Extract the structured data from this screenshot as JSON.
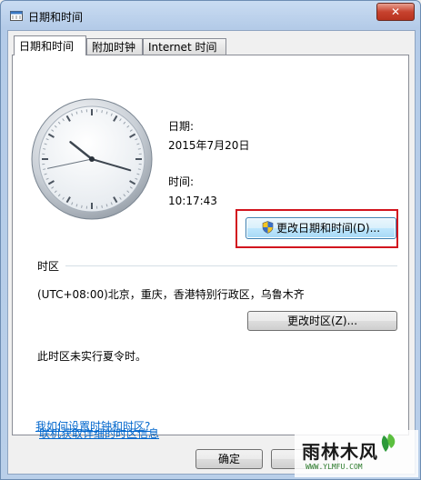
{
  "window": {
    "title": "日期和时间",
    "close_label": "✕"
  },
  "tabs": [
    {
      "label": "日期和时间",
      "active": true
    },
    {
      "label": "附加时钟",
      "active": false
    },
    {
      "label": "Internet 时间",
      "active": false
    }
  ],
  "clock": {
    "hours": 10,
    "minutes": 17,
    "seconds": 43
  },
  "date": {
    "label": "日期:",
    "value": "2015年7月20日"
  },
  "time": {
    "label": "时间:",
    "value": "10:17:43"
  },
  "change_date_button": {
    "label": "更改日期和时间(D)..."
  },
  "timezone": {
    "section_label": "时区",
    "value": "(UTC+08:00)北京，重庆，香港特别行政区，乌鲁木齐",
    "change_label": "更改时区(Z)..."
  },
  "dst_note": "此时区未实行夏令时。",
  "links": {
    "online_info": "联机获取详细的时区信息",
    "how_to": "我如何设置时钟和时区?"
  },
  "footer": {
    "ok_label": "确定"
  },
  "watermark": {
    "title": "雨林木风",
    "url": "WWW.YLMFU.COM"
  },
  "colors": {
    "highlight": "#d2141e",
    "link": "#0066cc"
  }
}
